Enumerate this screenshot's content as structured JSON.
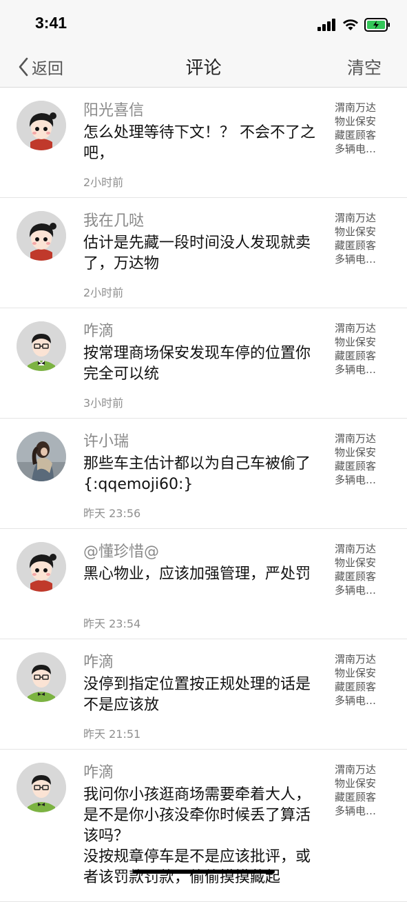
{
  "status_bar": {
    "time": "3:41"
  },
  "nav": {
    "back_label": "返回",
    "title": "评论",
    "clear_label": "清空"
  },
  "comments": [
    {
      "name": "阳光喜信",
      "text": "怎么处理等待下文！？ 不会不了之吧，",
      "time": "2小时前",
      "source": "渭南万达物业保安藏匿顾客多辆电…",
      "avatar": "cartoon-girl"
    },
    {
      "name": "我在几哒",
      "text": "估计是先藏一段时间没人发现就卖了，万达物",
      "time": "2小时前",
      "source": "渭南万达物业保安藏匿顾客多辆电…",
      "avatar": "cartoon-girl"
    },
    {
      "name": "咋滴",
      "text": "按常理商场保安发现车停的位置你完全可以统",
      "time": "3小时前",
      "source": "渭南万达物业保安藏匿顾客多辆电…",
      "avatar": "cartoon-boy"
    },
    {
      "name": "许小瑞",
      "text": "那些车主估计都以为自己车被偷了{:qqemoji60:}",
      "time": "昨天 23:56",
      "source": "渭南万达物业保安藏匿顾客多辆电…",
      "avatar": "photo"
    },
    {
      "name": "@懂珍惜@",
      "text": "黑心物业，应该加强管理，严处罚",
      "time": "昨天 23:54",
      "source": "渭南万达物业保安藏匿顾客多辆电…",
      "avatar": "cartoon-girl"
    },
    {
      "name": "咋滴",
      "text": "没停到指定位置按正规处理的话是不是应该放",
      "time": "昨天 21:51",
      "source": "渭南万达物业保安藏匿顾客多辆电…",
      "avatar": "cartoon-boy"
    },
    {
      "name": "咋滴",
      "text": "我问你小孩逛商场需要牵着大人，是不是你小孩没牵你时候丢了算活该吗？\n没按规章停车是不是应该批评，或者该罚款罚款，偷偷摸摸藏起",
      "time": "",
      "source": "渭南万达物业保安藏匿顾客多辆电…",
      "avatar": "cartoon-boy"
    }
  ]
}
